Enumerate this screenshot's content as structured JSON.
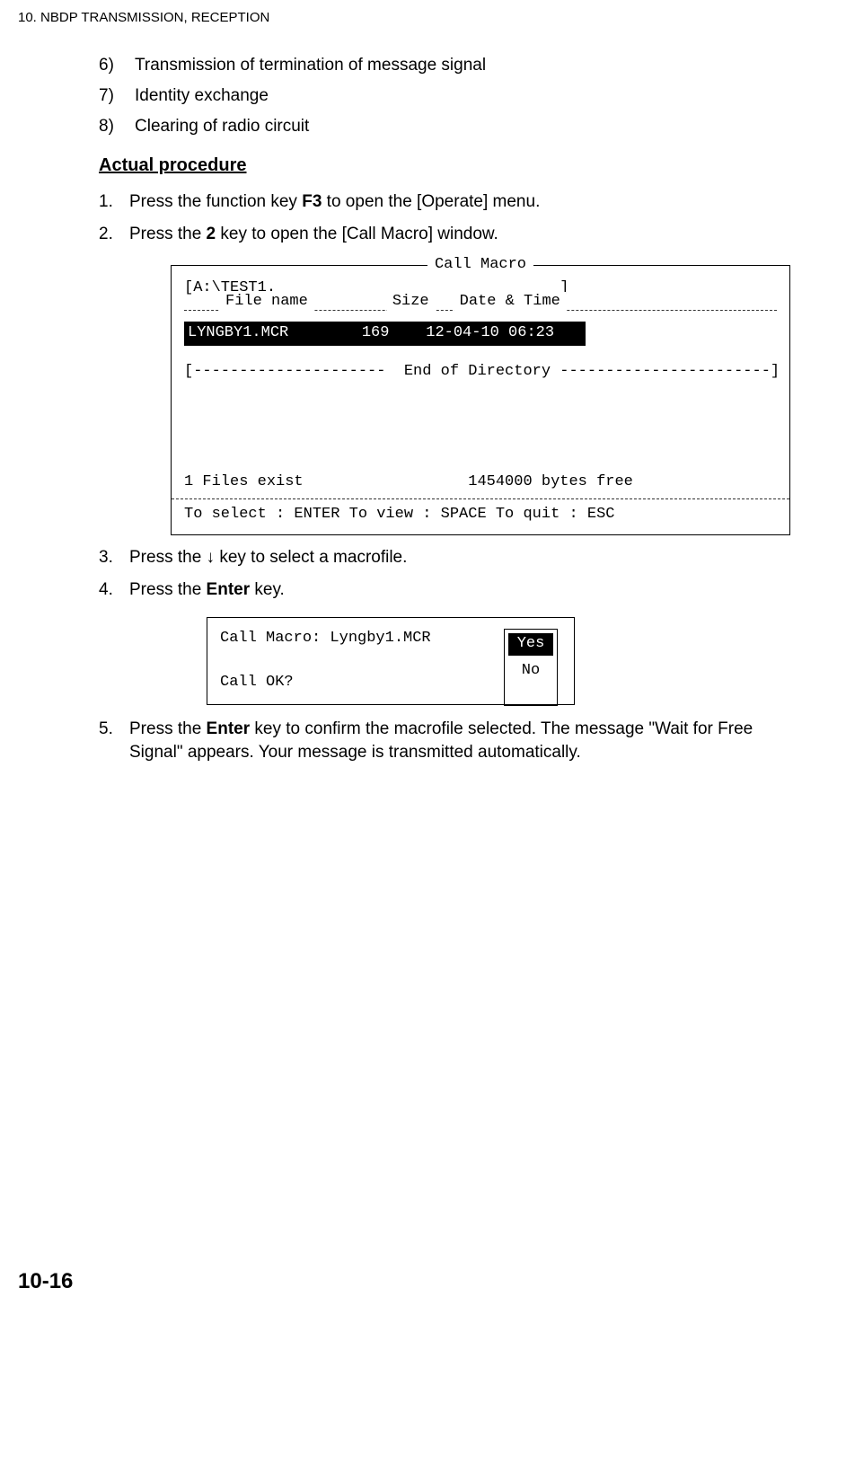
{
  "header": "10.  NBDP TRANSMISSION, RECEPTION",
  "list6": [
    {
      "n": "6)",
      "t": "Transmission of termination of message signal"
    },
    {
      "n": "7)",
      "t": "Identity exchange"
    },
    {
      "n": "8)",
      "t": "Clearing of radio circuit"
    }
  ],
  "actual_heading": "Actual procedure",
  "step1": {
    "n": "1.",
    "pre": "Press the function key ",
    "b": "F3",
    "post": " to open the [Operate] menu."
  },
  "step2": {
    "n": "2.",
    "pre": "Press the ",
    "b": "2",
    "post": " key to open the [Call Macro] window."
  },
  "terminal": {
    "title": "Call Macro",
    "path": "[A:\\TEST1.                               ]",
    "col_file": "File name",
    "col_size": "Size",
    "col_date": "Date & Time",
    "row": "LYNGBY1.MCR        169    12-04-10 06:23   ",
    "end": "[---------------------  End of Directory -----------------------]",
    "foot1": "1 Files exist                  1454000 bytes free",
    "foot2": "To select : ENTER  To view : SPACE  To quit : ESC"
  },
  "step3": {
    "n": "3.",
    "pre": "Press the ↓ key to select a macrofile."
  },
  "step4": {
    "n": "4.",
    "pre": "Press the ",
    "b": "Enter",
    "post": " key."
  },
  "confirm": {
    "line1": "Call Macro: Lyngby1.MCR",
    "line2": "Call OK?",
    "yes": "Yes",
    "no": "No"
  },
  "step5": {
    "n": "5.",
    "pre": "Press the ",
    "b": "Enter",
    "post": " key to confirm the macrofile selected. The message \"Wait for Free Signal\" appears. Your message is transmitted automatically."
  },
  "page_num": "10-16"
}
